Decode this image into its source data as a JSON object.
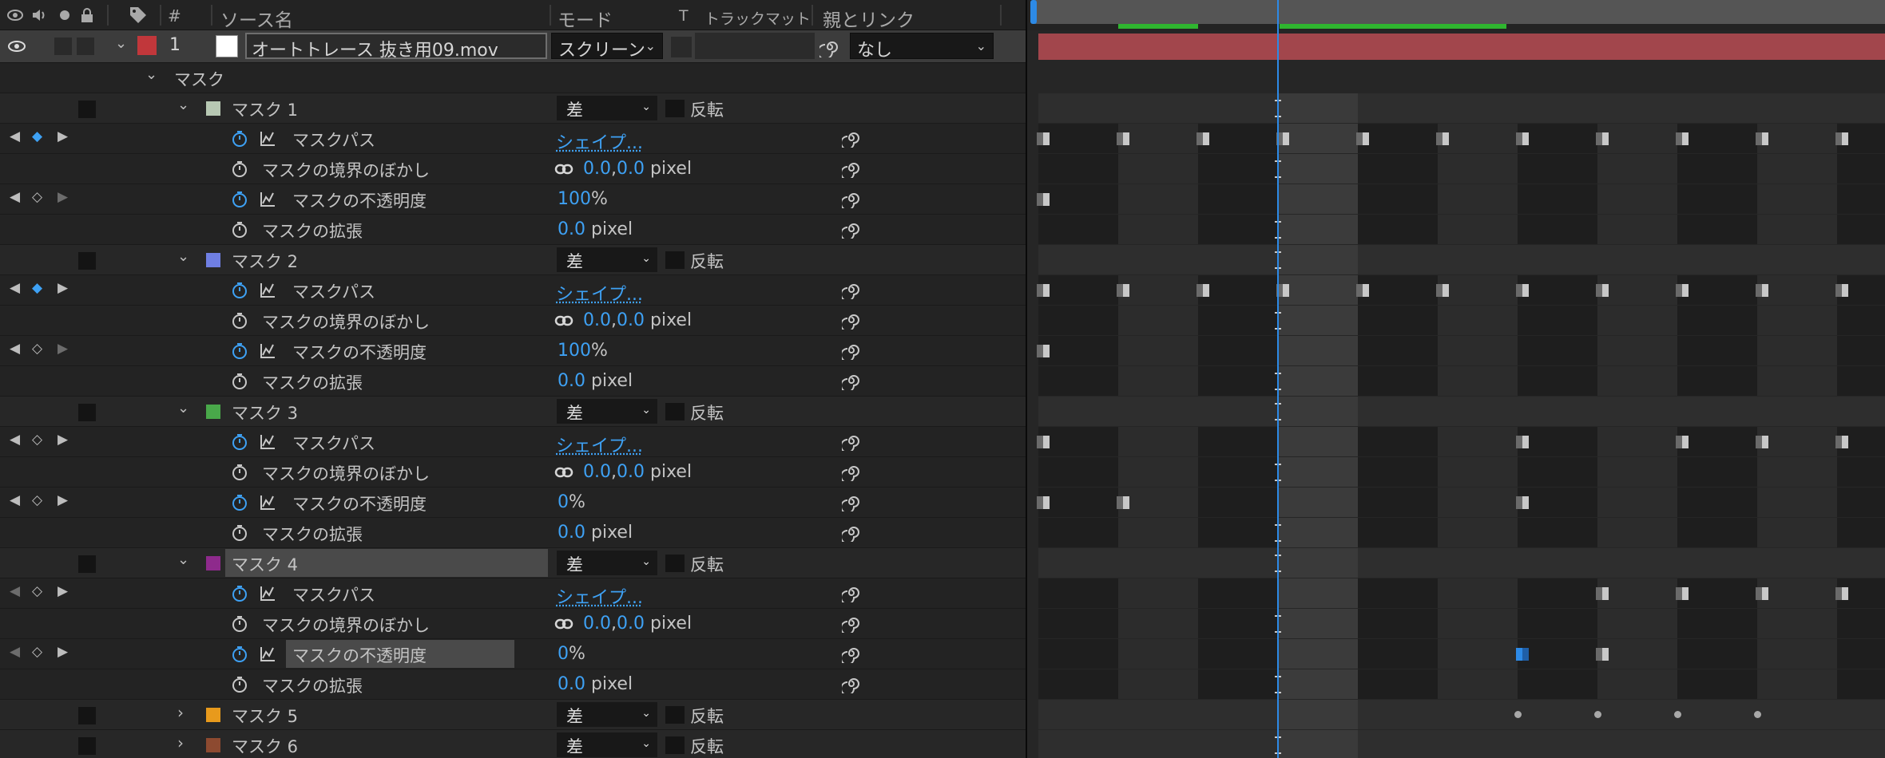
{
  "header": {
    "hash": "#",
    "source_name": "ソース名",
    "mode": "モード",
    "t": "T",
    "track_matte": "トラックマット",
    "parent_link": "親とリンク"
  },
  "layer": {
    "number": "1",
    "name": "オートトレース 抜き用09.mov",
    "mode_value": "スクリーン",
    "parent_value": "なし",
    "label_color": "#c1373b"
  },
  "masks_group_label": "マスク",
  "masks": [
    {
      "name": "マスク 1",
      "color": "#b7c8b3",
      "mode": "差",
      "invert": "反転",
      "props": {
        "path": "マスクパス",
        "path_val": "シェイプ...",
        "feather": "マスクの境界のぼかし",
        "feather_x": "0.0",
        "feather_y": "0.0",
        "feather_unit": "pixel",
        "opacity": "マスクの不透明度",
        "opacity_val": "100",
        "opacity_unit": "%",
        "expansion": "マスクの拡張",
        "expansion_val": "0.0",
        "expansion_unit": "pixel"
      }
    },
    {
      "name": "マスク 2",
      "color": "#6f7fe3",
      "mode": "差",
      "invert": "反転",
      "props": {
        "path": "マスクパス",
        "path_val": "シェイプ...",
        "feather": "マスクの境界のぼかし",
        "feather_x": "0.0",
        "feather_y": "0.0",
        "feather_unit": "pixel",
        "opacity": "マスクの不透明度",
        "opacity_val": "100",
        "opacity_unit": "%",
        "expansion": "マスクの拡張",
        "expansion_val": "0.0",
        "expansion_unit": "pixel"
      }
    },
    {
      "name": "マスク 3",
      "color": "#49a84a",
      "mode": "差",
      "invert": "反転",
      "props": {
        "path": "マスクパス",
        "path_val": "シェイプ...",
        "feather": "マスクの境界のぼかし",
        "feather_x": "0.0",
        "feather_y": "0.0",
        "feather_unit": "pixel",
        "opacity": "マスクの不透明度",
        "opacity_val": "0",
        "opacity_unit": "%",
        "expansion": "マスクの拡張",
        "expansion_val": "0.0",
        "expansion_unit": "pixel"
      }
    },
    {
      "name": "マスク 4",
      "color": "#8e2a8c",
      "mode": "差",
      "invert": "反転",
      "props": {
        "path": "マスクパス",
        "path_val": "シェイプ...",
        "feather": "マスクの境界のぼかし",
        "feather_x": "0.0",
        "feather_y": "0.0",
        "feather_unit": "pixel",
        "opacity": "マスクの不透明度",
        "opacity_val": "0",
        "opacity_unit": "%",
        "expansion": "マスクの拡張",
        "expansion_val": "0.0",
        "expansion_unit": "pixel"
      }
    }
  ],
  "collapsed_masks": [
    {
      "name": "マスク 5",
      "color": "#e89a1c",
      "mode": "差",
      "invert": "反転"
    },
    {
      "name": "マスク 6",
      "color": "#8d4a30",
      "mode": "差",
      "invert": "反転"
    }
  ],
  "colors": {
    "accent_blue": "#3ea1f4",
    "layer_bar": "#a2464c",
    "work_area": "#2fb52f"
  }
}
